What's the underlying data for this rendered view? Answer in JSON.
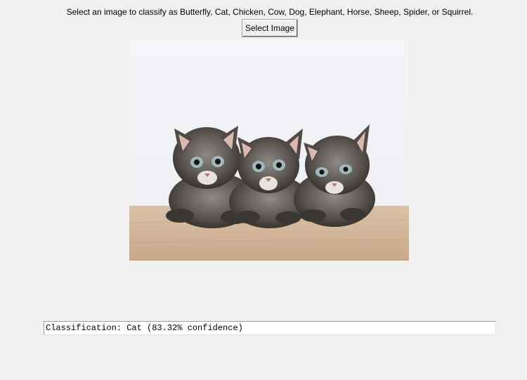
{
  "app": {
    "instruction": "Select an image to classify as Butterfly, Cat, Chicken, Cow, Dog, Elephant, Horse, Sheep, Spider, or Squirrel.",
    "select_button_label": "Select Image",
    "image": {
      "subject": "three tabby kittens lying side by side on a wooden floor against a white wall"
    },
    "result_text": "Classification: Cat (83.32% confidence)"
  }
}
